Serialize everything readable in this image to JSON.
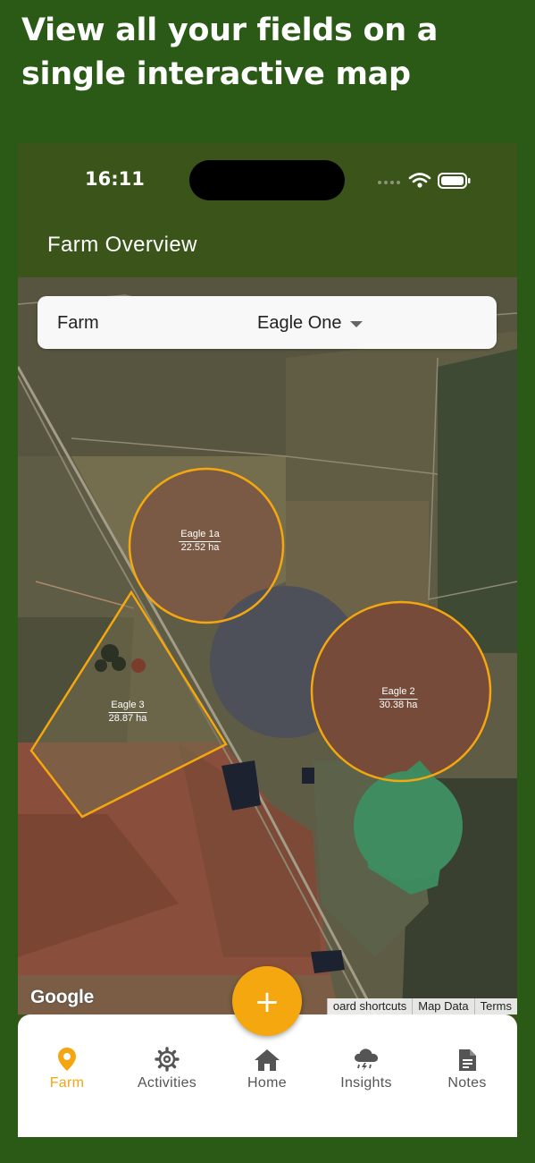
{
  "headline": "View all your fields on a single interactive map",
  "status_bar": {
    "time": "16:11"
  },
  "appbar": {
    "title": "Farm Overview"
  },
  "farm_selector": {
    "label": "Farm",
    "selected": "Eagle One"
  },
  "fields": [
    {
      "name": "Eagle 1a",
      "area": "22.52 ha"
    },
    {
      "name": "Eagle 2",
      "area": "30.38 ha"
    },
    {
      "name": "Eagle 3",
      "area": "28.87 ha"
    }
  ],
  "map": {
    "provider": "Google",
    "attribution": [
      "oard shortcuts",
      "Map Data",
      "Terms"
    ],
    "field_outline_color": "#f4a70f"
  },
  "fab": {
    "icon": "plus-icon",
    "label": "+"
  },
  "bottom_nav": {
    "items": [
      {
        "label": "Farm",
        "icon": "location-pin-icon",
        "active": true
      },
      {
        "label": "Activities",
        "icon": "gear-icon",
        "active": false
      },
      {
        "label": "Home",
        "icon": "home-icon",
        "active": false
      },
      {
        "label": "Insights",
        "icon": "storm-cloud-icon",
        "active": false
      },
      {
        "label": "Notes",
        "icon": "document-icon",
        "active": false
      }
    ],
    "active_color": "#f5a511"
  }
}
